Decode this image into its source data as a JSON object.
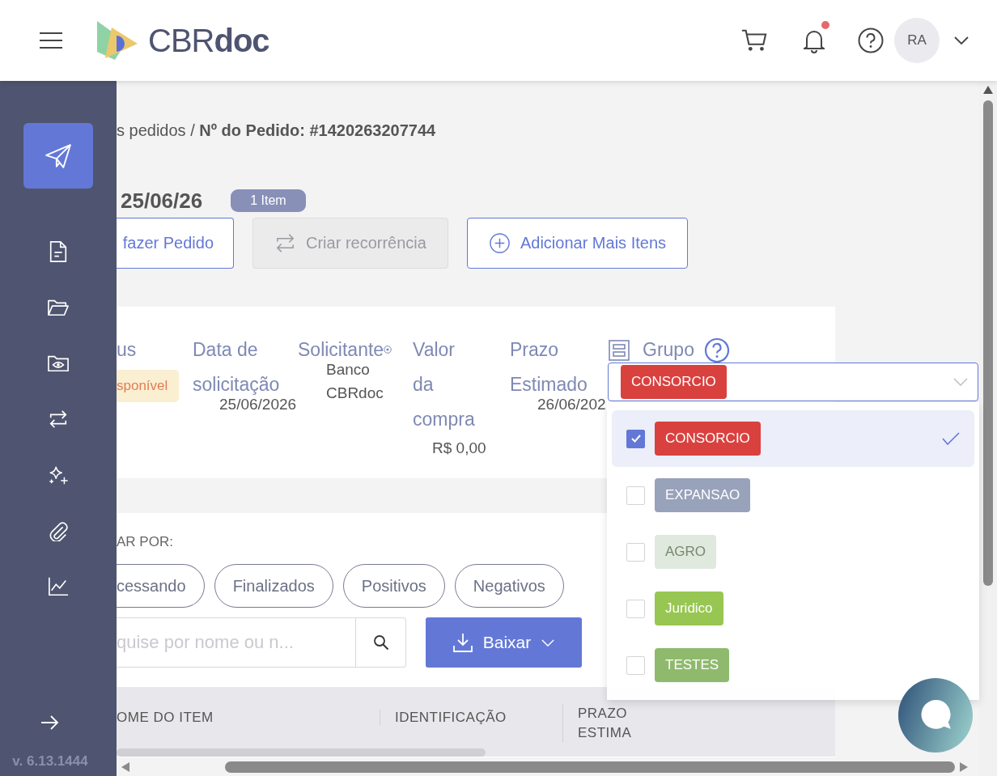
{
  "header": {
    "logo_text": "CBR**doc**",
    "notification_dot": true,
    "avatar_initials": "RA"
  },
  "sidebar": {
    "items": [
      {
        "kind": "send",
        "selected": true
      },
      {
        "kind": "document",
        "selected": false
      },
      {
        "kind": "folder",
        "selected": false
      },
      {
        "kind": "eye-folder",
        "selected": false
      },
      {
        "kind": "repeat",
        "selected": false
      },
      {
        "kind": "sparkles",
        "selected": false
      },
      {
        "kind": "paperclip",
        "selected": false
      },
      {
        "kind": "chart",
        "selected": false
      }
    ],
    "version": "v. 6.13.1444"
  },
  "breadcrumb": "s pedidos / **Nº do Pedido: #1420263207744**",
  "order": {
    "date": "25/06/26",
    "item_count": "1 Item"
  },
  "actions": [
    {
      "kind": "plain",
      "label": "fazer Pedido",
      "disabled": false
    },
    {
      "kind": "repeat",
      "label": "Criar recorrência",
      "disabled": true
    },
    {
      "kind": "add",
      "label": "Adicionar Mais Itens",
      "disabled": false
    }
  ],
  "details": {
    "status": {
      "heading": "us",
      "badge": "sponível"
    },
    "fields": [
      {
        "heading": "Data de\nsolicitação",
        "value": "25/06/2026",
        "info": false
      },
      {
        "heading": "Solicitante",
        "value": "Banco CBRdoc",
        "info": true
      },
      {
        "heading": "Valor\nda\ncompra",
        "value": "R$ 0,00",
        "info": false
      },
      {
        "heading": "Prazo\nEstimado",
        "value": "26/06/202",
        "info": false
      }
    ],
    "group": {
      "heading": "Grupo",
      "selected_tag": {
        "label": "CONSORCIO",
        "color": "#d9413f"
      },
      "options": [
        {
          "label": "CONSORCIO",
          "color": "#d9413f",
          "selected": true,
          "disabled": false
        },
        {
          "label": "EXPANSAO",
          "color": "#99a2bb",
          "selected": false,
          "disabled": false
        },
        {
          "label": "AGRO",
          "color": "#dfe9dd",
          "selected": false,
          "disabled": true
        },
        {
          "label": "Juridico",
          "color": "#97c652",
          "selected": false,
          "disabled": false
        },
        {
          "label": "TESTES",
          "color": "#8fba6d",
          "selected": false,
          "disabled": false
        }
      ]
    }
  },
  "filters": {
    "label": "AR POR:",
    "chips": [
      "cessando",
      "Finalizados",
      "Positivos",
      "Negativos"
    ]
  },
  "search": {
    "placeholder": "quise por nome ou n..."
  },
  "download_button": {
    "label": "Baixar"
  },
  "table": {
    "columns": [
      "OME DO ITEM",
      "IDENTIFICAÇÃO",
      "PRAZO ESTIMA"
    ]
  }
}
